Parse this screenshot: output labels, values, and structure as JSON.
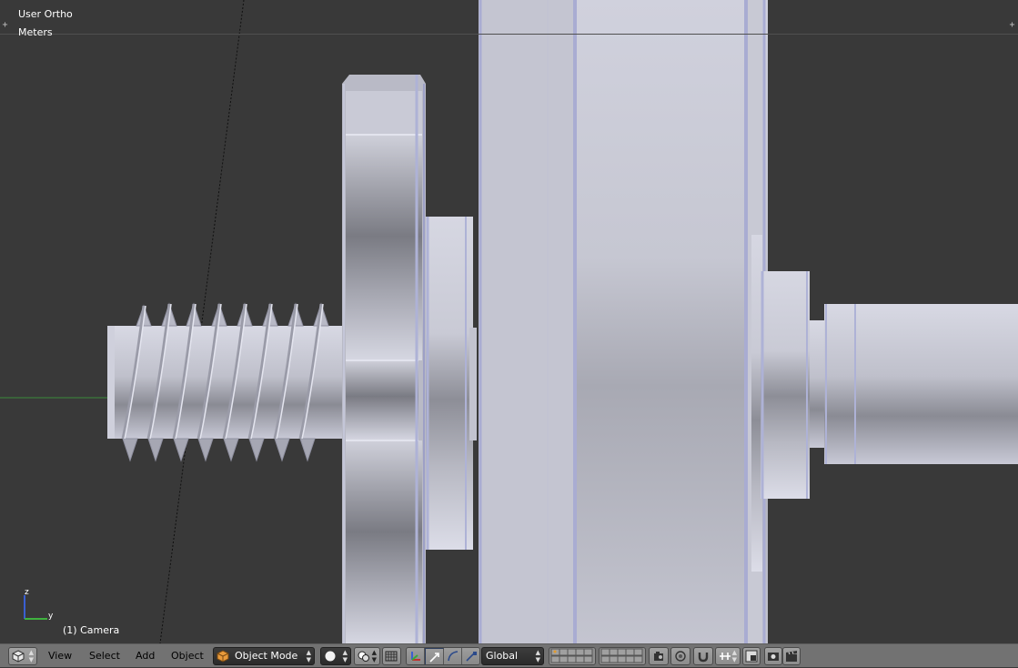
{
  "viewport": {
    "view_name": "User Ortho",
    "units": "Meters",
    "object_info": "(1) Camera",
    "axes": {
      "z_label": "z",
      "y_label": "y"
    }
  },
  "header": {
    "view_menu": "View",
    "select_menu": "Select",
    "add_menu": "Add",
    "object_menu": "Object",
    "mode": "Object Mode",
    "orientation": "Global"
  },
  "colors": {
    "viewport_bg": "#393939",
    "header_bg": "#727272",
    "metal_light": "#d9dae6",
    "metal_dark": "#7c7d86",
    "edge_highlight": "#aeb2d6",
    "y_axis_line": "#3c8a3c",
    "active_blue": "#5b7fbf"
  },
  "icons": {
    "editor_type": "cube-icon",
    "mode": "object-mode-cube-icon",
    "shading": "solid-sphere-icon",
    "pivot": "pivot-point-icon",
    "manipulator": "manipulator-axes-icon",
    "translate": "translate-arrow-icon",
    "rotate": "rotate-arc-icon",
    "scale": "scale-icon",
    "layers": "layers-grid-icon",
    "lock_layer": "lock-camera-icon",
    "proportional": "proportional-edit-icon",
    "snap": "snap-magnet-icon",
    "snap_element": "snap-element-icon",
    "render": "render-camera-icon",
    "render_anim": "render-clapper-icon"
  }
}
